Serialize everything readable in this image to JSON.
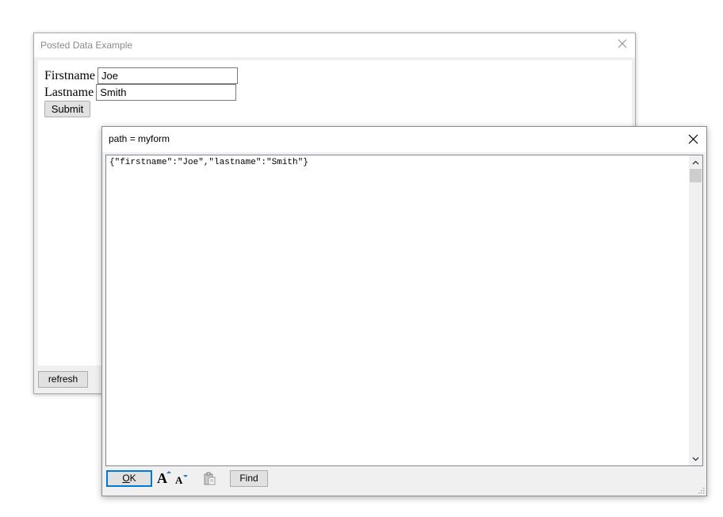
{
  "back_window": {
    "title": "Posted Data Example",
    "close_icon": "close-icon",
    "form": {
      "firstname_label": "Firstname",
      "firstname_value": "Joe",
      "lastname_label": "Lastname",
      "lastname_value": "Smith",
      "submit_label": "Submit"
    },
    "refresh_label": "refresh"
  },
  "front_window": {
    "title": "path = myform",
    "close_icon": "close-icon",
    "editor_text": "{\"firstname\":\"Joe\",\"lastname\":\"Smith\"}",
    "footer": {
      "ok_label_underlined": "O",
      "ok_label_rest": "K",
      "font_larger_glyph": "A",
      "font_smaller_glyph": "A",
      "clipboard_icon": "clipboard-icon",
      "find_label": "Find"
    }
  },
  "colors": {
    "focus_border": "#0078d7",
    "button_face": "#e1e1e1",
    "window_bg": "#f0f0f0",
    "font_arrow": "#3a6fc7"
  }
}
